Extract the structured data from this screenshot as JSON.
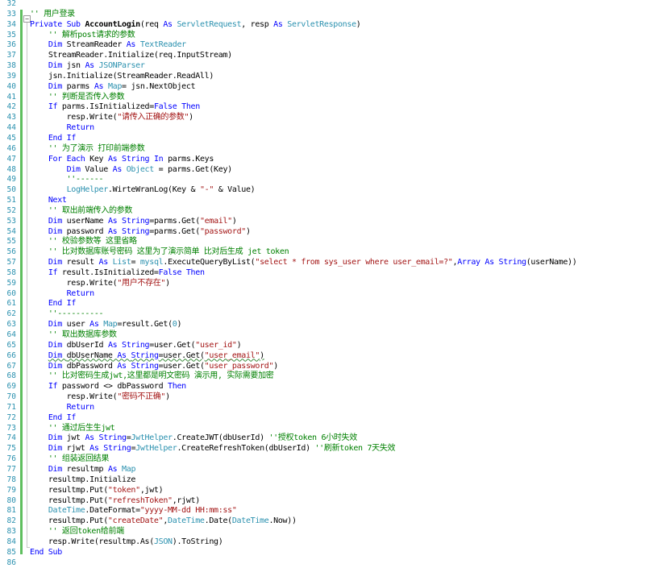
{
  "editor": {
    "name": "vb-code-editor",
    "colors": {
      "keyword": "#0000ff",
      "type": "#2b91af",
      "string": "#a31515",
      "comment": "#008000",
      "line_number": "#2b91af",
      "change_bar": "#5fbf5f"
    },
    "collapse_glyph": "−",
    "lines": [
      {
        "n": "32",
        "indent": "",
        "tokens": []
      },
      {
        "n": "33",
        "indent": "",
        "tokens": [
          {
            "t": "'' 用户登录",
            "c": "cm"
          }
        ]
      },
      {
        "n": "34",
        "indent": "",
        "tokens": [
          {
            "t": "Private Sub ",
            "c": "kw"
          },
          {
            "t": "AccountLogin",
            "c": "bd"
          },
          {
            "t": "(req ",
            "c": "pl"
          },
          {
            "t": "As ",
            "c": "kw"
          },
          {
            "t": "ServletRequest",
            "c": "ty"
          },
          {
            "t": ", resp ",
            "c": "pl"
          },
          {
            "t": "As ",
            "c": "kw"
          },
          {
            "t": "ServletResponse",
            "c": "ty"
          },
          {
            "t": ")",
            "c": "pl"
          }
        ]
      },
      {
        "n": "35",
        "indent": "    ",
        "tokens": [
          {
            "t": "'' 解析post请求的参数",
            "c": "cm"
          }
        ]
      },
      {
        "n": "36",
        "indent": "    ",
        "tokens": [
          {
            "t": "Dim ",
            "c": "kw"
          },
          {
            "t": "StreamReader ",
            "c": "pl"
          },
          {
            "t": "As ",
            "c": "kw"
          },
          {
            "t": "TextReader",
            "c": "ty"
          }
        ]
      },
      {
        "n": "37",
        "indent": "    ",
        "tokens": [
          {
            "t": "StreamReader.Initialize(req.InputStream)",
            "c": "pl"
          }
        ]
      },
      {
        "n": "38",
        "indent": "    ",
        "tokens": [
          {
            "t": "Dim ",
            "c": "kw"
          },
          {
            "t": "jsn ",
            "c": "pl"
          },
          {
            "t": "As ",
            "c": "kw"
          },
          {
            "t": "JSONParser",
            "c": "ty"
          }
        ]
      },
      {
        "n": "39",
        "indent": "    ",
        "tokens": [
          {
            "t": "jsn.Initialize(StreamReader.ReadAll)",
            "c": "pl"
          }
        ]
      },
      {
        "n": "40",
        "indent": "    ",
        "tokens": [
          {
            "t": "Dim ",
            "c": "kw"
          },
          {
            "t": "parms ",
            "c": "pl"
          },
          {
            "t": "As ",
            "c": "kw"
          },
          {
            "t": "Map",
            "c": "ty"
          },
          {
            "t": "= jsn.NextObject",
            "c": "pl"
          }
        ]
      },
      {
        "n": "41",
        "indent": "    ",
        "tokens": [
          {
            "t": "'' 判断是否传入参数",
            "c": "cm"
          }
        ]
      },
      {
        "n": "42",
        "indent": "    ",
        "tokens": [
          {
            "t": "If ",
            "c": "kw"
          },
          {
            "t": "parms.IsInitialized=",
            "c": "pl"
          },
          {
            "t": "False ",
            "c": "kw"
          },
          {
            "t": "Then",
            "c": "kw"
          }
        ]
      },
      {
        "n": "43",
        "indent": "        ",
        "tokens": [
          {
            "t": "resp.Write(",
            "c": "pl"
          },
          {
            "t": "\"请传入正确的参数\"",
            "c": "st"
          },
          {
            "t": ")",
            "c": "pl"
          }
        ]
      },
      {
        "n": "44",
        "indent": "        ",
        "tokens": [
          {
            "t": "Return",
            "c": "kw"
          }
        ]
      },
      {
        "n": "45",
        "indent": "    ",
        "tokens": [
          {
            "t": "End If",
            "c": "kw"
          }
        ]
      },
      {
        "n": "46",
        "indent": "    ",
        "tokens": [
          {
            "t": "'' 为了演示 打印前端参数",
            "c": "cm"
          }
        ]
      },
      {
        "n": "47",
        "indent": "    ",
        "tokens": [
          {
            "t": "For Each ",
            "c": "kw"
          },
          {
            "t": "Key ",
            "c": "pl"
          },
          {
            "t": "As ",
            "c": "kw"
          },
          {
            "t": "String ",
            "c": "kw"
          },
          {
            "t": "In ",
            "c": "kw"
          },
          {
            "t": "parms.Keys",
            "c": "pl"
          }
        ]
      },
      {
        "n": "48",
        "indent": "        ",
        "tokens": [
          {
            "t": "Dim ",
            "c": "kw"
          },
          {
            "t": "Value ",
            "c": "pl"
          },
          {
            "t": "As ",
            "c": "kw"
          },
          {
            "t": "Object ",
            "c": "ty"
          },
          {
            "t": "= parms.Get(Key)",
            "c": "pl"
          }
        ]
      },
      {
        "n": "49",
        "indent": "        ",
        "tokens": [
          {
            "t": "''------",
            "c": "cm"
          }
        ]
      },
      {
        "n": "50",
        "indent": "        ",
        "tokens": [
          {
            "t": "LogHelper",
            "c": "ty"
          },
          {
            "t": ".WirteWranLog(Key & ",
            "c": "pl"
          },
          {
            "t": "\"-\"",
            "c": "st"
          },
          {
            "t": " & Value)",
            "c": "pl"
          }
        ]
      },
      {
        "n": "51",
        "indent": "    ",
        "tokens": [
          {
            "t": "Next",
            "c": "kw"
          }
        ]
      },
      {
        "n": "52",
        "indent": "    ",
        "tokens": [
          {
            "t": "'' 取出前端传入的参数",
            "c": "cm"
          }
        ]
      },
      {
        "n": "53",
        "indent": "    ",
        "tokens": [
          {
            "t": "Dim ",
            "c": "kw"
          },
          {
            "t": "userName ",
            "c": "pl"
          },
          {
            "t": "As ",
            "c": "kw"
          },
          {
            "t": "String",
            "c": "kw"
          },
          {
            "t": "=parms.Get(",
            "c": "pl"
          },
          {
            "t": "\"email\"",
            "c": "st"
          },
          {
            "t": ")",
            "c": "pl"
          }
        ]
      },
      {
        "n": "54",
        "indent": "    ",
        "tokens": [
          {
            "t": "Dim ",
            "c": "kw"
          },
          {
            "t": "password ",
            "c": "pl"
          },
          {
            "t": "As ",
            "c": "kw"
          },
          {
            "t": "String",
            "c": "kw"
          },
          {
            "t": "=parms.Get(",
            "c": "pl"
          },
          {
            "t": "\"password\"",
            "c": "st"
          },
          {
            "t": ")",
            "c": "pl"
          }
        ]
      },
      {
        "n": "55",
        "indent": "    ",
        "tokens": [
          {
            "t": "'' 校验参数等 这里省略",
            "c": "cm"
          }
        ]
      },
      {
        "n": "56",
        "indent": "    ",
        "tokens": [
          {
            "t": "'' 比对数据库账号密码 这里为了演示简单 比对后生成 jet token",
            "c": "cm"
          }
        ]
      },
      {
        "n": "57",
        "indent": "    ",
        "tokens": [
          {
            "t": "Dim ",
            "c": "kw"
          },
          {
            "t": "result ",
            "c": "pl"
          },
          {
            "t": "As ",
            "c": "kw"
          },
          {
            "t": "List",
            "c": "ty"
          },
          {
            "t": "= ",
            "c": "pl"
          },
          {
            "t": "mysql",
            "c": "ty"
          },
          {
            "t": ".ExecuteQueryByList(",
            "c": "pl"
          },
          {
            "t": "\"select * from sys_user where user_email=?\"",
            "c": "st"
          },
          {
            "t": ",",
            "c": "pl"
          },
          {
            "t": "Array ",
            "c": "kw"
          },
          {
            "t": "As ",
            "c": "kw"
          },
          {
            "t": "String",
            "c": "kw"
          },
          {
            "t": "(userName))",
            "c": "pl"
          }
        ]
      },
      {
        "n": "58",
        "indent": "    ",
        "tokens": [
          {
            "t": "If ",
            "c": "kw"
          },
          {
            "t": "result.IsInitialized=",
            "c": "pl"
          },
          {
            "t": "False ",
            "c": "kw"
          },
          {
            "t": "Then",
            "c": "kw"
          }
        ]
      },
      {
        "n": "59",
        "indent": "        ",
        "tokens": [
          {
            "t": "resp.Write(",
            "c": "pl"
          },
          {
            "t": "\"用户不存在\"",
            "c": "st"
          },
          {
            "t": ")",
            "c": "pl"
          }
        ]
      },
      {
        "n": "60",
        "indent": "        ",
        "tokens": [
          {
            "t": "Return",
            "c": "kw"
          }
        ]
      },
      {
        "n": "61",
        "indent": "    ",
        "tokens": [
          {
            "t": "End If",
            "c": "kw"
          }
        ]
      },
      {
        "n": "62",
        "indent": "    ",
        "tokens": [
          {
            "t": "''----------",
            "c": "cm"
          }
        ]
      },
      {
        "n": "63",
        "indent": "    ",
        "tokens": [
          {
            "t": "Dim ",
            "c": "kw"
          },
          {
            "t": "user ",
            "c": "pl"
          },
          {
            "t": "As ",
            "c": "kw"
          },
          {
            "t": "Map",
            "c": "ty"
          },
          {
            "t": "=result.Get(",
            "c": "pl"
          },
          {
            "t": "0",
            "c": "ty"
          },
          {
            "t": ")",
            "c": "pl"
          }
        ]
      },
      {
        "n": "64",
        "indent": "    ",
        "tokens": [
          {
            "t": "'' 取出数据库参数",
            "c": "cm"
          }
        ]
      },
      {
        "n": "65",
        "indent": "    ",
        "tokens": [
          {
            "t": "Dim ",
            "c": "kw"
          },
          {
            "t": "dbUserId ",
            "c": "pl"
          },
          {
            "t": "As ",
            "c": "kw"
          },
          {
            "t": "String",
            "c": "kw"
          },
          {
            "t": "=user.Get(",
            "c": "pl"
          },
          {
            "t": "\"user_id\"",
            "c": "st"
          },
          {
            "t": ")",
            "c": "pl"
          }
        ]
      },
      {
        "n": "66",
        "indent": "    ",
        "squiggle": true,
        "tokens": [
          {
            "t": "Dim ",
            "c": "kw"
          },
          {
            "t": "dbUserName ",
            "c": "pl"
          },
          {
            "t": "As ",
            "c": "kw"
          },
          {
            "t": "String",
            "c": "kw"
          },
          {
            "t": "=user.Get(",
            "c": "pl"
          },
          {
            "t": "\"user_email\"",
            "c": "st"
          },
          {
            "t": ")",
            "c": "pl"
          }
        ]
      },
      {
        "n": "67",
        "indent": "    ",
        "tokens": [
          {
            "t": "Dim ",
            "c": "kw"
          },
          {
            "t": "dbPassword ",
            "c": "pl"
          },
          {
            "t": "As ",
            "c": "kw"
          },
          {
            "t": "String",
            "c": "kw"
          },
          {
            "t": "=user.Get(",
            "c": "pl"
          },
          {
            "t": "\"user_password\"",
            "c": "st"
          },
          {
            "t": ")",
            "c": "pl"
          }
        ]
      },
      {
        "n": "68",
        "indent": "    ",
        "tokens": [
          {
            "t": "'' 比对密码生成jwt,这里都是明文密码 演示用, 实际需要加密",
            "c": "cm"
          }
        ]
      },
      {
        "n": "69",
        "indent": "    ",
        "tokens": [
          {
            "t": "If ",
            "c": "kw"
          },
          {
            "t": "password <> dbPassword ",
            "c": "pl"
          },
          {
            "t": "Then",
            "c": "kw"
          }
        ]
      },
      {
        "n": "70",
        "indent": "        ",
        "tokens": [
          {
            "t": "resp.Write(",
            "c": "pl"
          },
          {
            "t": "\"密码不正确\"",
            "c": "st"
          },
          {
            "t": ")",
            "c": "pl"
          }
        ]
      },
      {
        "n": "71",
        "indent": "        ",
        "tokens": [
          {
            "t": "Return",
            "c": "kw"
          }
        ]
      },
      {
        "n": "72",
        "indent": "    ",
        "tokens": [
          {
            "t": "End If",
            "c": "kw"
          }
        ]
      },
      {
        "n": "73",
        "indent": "    ",
        "tokens": [
          {
            "t": "'' 通过后生生jwt",
            "c": "cm"
          }
        ]
      },
      {
        "n": "74",
        "indent": "    ",
        "tokens": [
          {
            "t": "Dim ",
            "c": "kw"
          },
          {
            "t": "jwt ",
            "c": "pl"
          },
          {
            "t": "As ",
            "c": "kw"
          },
          {
            "t": "String",
            "c": "kw"
          },
          {
            "t": "=",
            "c": "pl"
          },
          {
            "t": "JwtHelper",
            "c": "ty"
          },
          {
            "t": ".CreateJWT(dbUserId) ",
            "c": "pl"
          },
          {
            "t": "''授权token 6小时失效",
            "c": "cm"
          }
        ]
      },
      {
        "n": "75",
        "indent": "    ",
        "tokens": [
          {
            "t": "Dim ",
            "c": "kw"
          },
          {
            "t": "rjwt ",
            "c": "pl"
          },
          {
            "t": "As ",
            "c": "kw"
          },
          {
            "t": "String",
            "c": "kw"
          },
          {
            "t": "=",
            "c": "pl"
          },
          {
            "t": "JwtHelper",
            "c": "ty"
          },
          {
            "t": ".CreateRefreshToken(dbUserId) ",
            "c": "pl"
          },
          {
            "t": "''刷新token 7天失效",
            "c": "cm"
          }
        ]
      },
      {
        "n": "76",
        "indent": "    ",
        "tokens": [
          {
            "t": "'' 组装返回结果",
            "c": "cm"
          }
        ]
      },
      {
        "n": "77",
        "indent": "    ",
        "tokens": [
          {
            "t": "Dim ",
            "c": "kw"
          },
          {
            "t": "resultmp ",
            "c": "pl"
          },
          {
            "t": "As ",
            "c": "kw"
          },
          {
            "t": "Map",
            "c": "ty"
          }
        ]
      },
      {
        "n": "78",
        "indent": "    ",
        "tokens": [
          {
            "t": "resultmp.Initialize",
            "c": "pl"
          }
        ]
      },
      {
        "n": "79",
        "indent": "    ",
        "tokens": [
          {
            "t": "resultmp.Put(",
            "c": "pl"
          },
          {
            "t": "\"token\"",
            "c": "st"
          },
          {
            "t": ",jwt)",
            "c": "pl"
          }
        ]
      },
      {
        "n": "80",
        "indent": "    ",
        "tokens": [
          {
            "t": "resultmp.Put(",
            "c": "pl"
          },
          {
            "t": "\"refreshToken\"",
            "c": "st"
          },
          {
            "t": ",rjwt)",
            "c": "pl"
          }
        ]
      },
      {
        "n": "81",
        "indent": "    ",
        "tokens": [
          {
            "t": "DateTime",
            "c": "ty"
          },
          {
            "t": ".DateFormat=",
            "c": "pl"
          },
          {
            "t": "\"yyyy-MM-dd HH:mm:ss\"",
            "c": "st"
          }
        ]
      },
      {
        "n": "82",
        "indent": "    ",
        "tokens": [
          {
            "t": "resultmp.Put(",
            "c": "pl"
          },
          {
            "t": "\"createDate\"",
            "c": "st"
          },
          {
            "t": ",",
            "c": "pl"
          },
          {
            "t": "DateTime",
            "c": "ty"
          },
          {
            "t": ".Date(",
            "c": "pl"
          },
          {
            "t": "DateTime",
            "c": "ty"
          },
          {
            "t": ".Now))",
            "c": "pl"
          }
        ]
      },
      {
        "n": "83",
        "indent": "    ",
        "tokens": [
          {
            "t": "'' 返回token给前端",
            "c": "cm"
          }
        ]
      },
      {
        "n": "84",
        "indent": "    ",
        "tokens": [
          {
            "t": "resp.Write(resultmp.As(",
            "c": "pl"
          },
          {
            "t": "JSON",
            "c": "ty"
          },
          {
            "t": ").ToString)",
            "c": "pl"
          }
        ]
      },
      {
        "n": "85",
        "indent": "",
        "tokens": [
          {
            "t": "End Sub",
            "c": "kw"
          }
        ]
      },
      {
        "n": "86",
        "indent": "",
        "tokens": []
      }
    ]
  }
}
